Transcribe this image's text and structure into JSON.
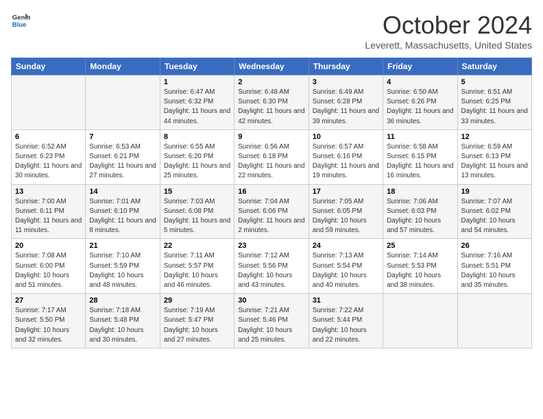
{
  "logo": {
    "text1": "General",
    "text2": "Blue"
  },
  "title": "October 2024",
  "location": "Leverett, Massachusetts, United States",
  "weekdays": [
    "Sunday",
    "Monday",
    "Tuesday",
    "Wednesday",
    "Thursday",
    "Friday",
    "Saturday"
  ],
  "weeks": [
    [
      {
        "day": "",
        "sunrise": "",
        "sunset": "",
        "daylight": ""
      },
      {
        "day": "",
        "sunrise": "",
        "sunset": "",
        "daylight": ""
      },
      {
        "day": "1",
        "sunrise": "Sunrise: 6:47 AM",
        "sunset": "Sunset: 6:32 PM",
        "daylight": "Daylight: 11 hours and 44 minutes."
      },
      {
        "day": "2",
        "sunrise": "Sunrise: 6:48 AM",
        "sunset": "Sunset: 6:30 PM",
        "daylight": "Daylight: 11 hours and 42 minutes."
      },
      {
        "day": "3",
        "sunrise": "Sunrise: 6:49 AM",
        "sunset": "Sunset: 6:28 PM",
        "daylight": "Daylight: 11 hours and 39 minutes."
      },
      {
        "day": "4",
        "sunrise": "Sunrise: 6:50 AM",
        "sunset": "Sunset: 6:26 PM",
        "daylight": "Daylight: 11 hours and 36 minutes."
      },
      {
        "day": "5",
        "sunrise": "Sunrise: 6:51 AM",
        "sunset": "Sunset: 6:25 PM",
        "daylight": "Daylight: 11 hours and 33 minutes."
      }
    ],
    [
      {
        "day": "6",
        "sunrise": "Sunrise: 6:52 AM",
        "sunset": "Sunset: 6:23 PM",
        "daylight": "Daylight: 11 hours and 30 minutes."
      },
      {
        "day": "7",
        "sunrise": "Sunrise: 6:53 AM",
        "sunset": "Sunset: 6:21 PM",
        "daylight": "Daylight: 11 hours and 27 minutes."
      },
      {
        "day": "8",
        "sunrise": "Sunrise: 6:55 AM",
        "sunset": "Sunset: 6:20 PM",
        "daylight": "Daylight: 11 hours and 25 minutes."
      },
      {
        "day": "9",
        "sunrise": "Sunrise: 6:56 AM",
        "sunset": "Sunset: 6:18 PM",
        "daylight": "Daylight: 11 hours and 22 minutes."
      },
      {
        "day": "10",
        "sunrise": "Sunrise: 6:57 AM",
        "sunset": "Sunset: 6:16 PM",
        "daylight": "Daylight: 11 hours and 19 minutes."
      },
      {
        "day": "11",
        "sunrise": "Sunrise: 6:58 AM",
        "sunset": "Sunset: 6:15 PM",
        "daylight": "Daylight: 11 hours and 16 minutes."
      },
      {
        "day": "12",
        "sunrise": "Sunrise: 6:59 AM",
        "sunset": "Sunset: 6:13 PM",
        "daylight": "Daylight: 11 hours and 13 minutes."
      }
    ],
    [
      {
        "day": "13",
        "sunrise": "Sunrise: 7:00 AM",
        "sunset": "Sunset: 6:11 PM",
        "daylight": "Daylight: 11 hours and 11 minutes."
      },
      {
        "day": "14",
        "sunrise": "Sunrise: 7:01 AM",
        "sunset": "Sunset: 6:10 PM",
        "daylight": "Daylight: 11 hours and 8 minutes."
      },
      {
        "day": "15",
        "sunrise": "Sunrise: 7:03 AM",
        "sunset": "Sunset: 6:08 PM",
        "daylight": "Daylight: 11 hours and 5 minutes."
      },
      {
        "day": "16",
        "sunrise": "Sunrise: 7:04 AM",
        "sunset": "Sunset: 6:06 PM",
        "daylight": "Daylight: 11 hours and 2 minutes."
      },
      {
        "day": "17",
        "sunrise": "Sunrise: 7:05 AM",
        "sunset": "Sunset: 6:05 PM",
        "daylight": "Daylight: 10 hours and 59 minutes."
      },
      {
        "day": "18",
        "sunrise": "Sunrise: 7:06 AM",
        "sunset": "Sunset: 6:03 PM",
        "daylight": "Daylight: 10 hours and 57 minutes."
      },
      {
        "day": "19",
        "sunrise": "Sunrise: 7:07 AM",
        "sunset": "Sunset: 6:02 PM",
        "daylight": "Daylight: 10 hours and 54 minutes."
      }
    ],
    [
      {
        "day": "20",
        "sunrise": "Sunrise: 7:08 AM",
        "sunset": "Sunset: 6:00 PM",
        "daylight": "Daylight: 10 hours and 51 minutes."
      },
      {
        "day": "21",
        "sunrise": "Sunrise: 7:10 AM",
        "sunset": "Sunset: 5:59 PM",
        "daylight": "Daylight: 10 hours and 48 minutes."
      },
      {
        "day": "22",
        "sunrise": "Sunrise: 7:11 AM",
        "sunset": "Sunset: 5:57 PM",
        "daylight": "Daylight: 10 hours and 46 minutes."
      },
      {
        "day": "23",
        "sunrise": "Sunrise: 7:12 AM",
        "sunset": "Sunset: 5:56 PM",
        "daylight": "Daylight: 10 hours and 43 minutes."
      },
      {
        "day": "24",
        "sunrise": "Sunrise: 7:13 AM",
        "sunset": "Sunset: 5:54 PM",
        "daylight": "Daylight: 10 hours and 40 minutes."
      },
      {
        "day": "25",
        "sunrise": "Sunrise: 7:14 AM",
        "sunset": "Sunset: 5:53 PM",
        "daylight": "Daylight: 10 hours and 38 minutes."
      },
      {
        "day": "26",
        "sunrise": "Sunrise: 7:16 AM",
        "sunset": "Sunset: 5:51 PM",
        "daylight": "Daylight: 10 hours and 35 minutes."
      }
    ],
    [
      {
        "day": "27",
        "sunrise": "Sunrise: 7:17 AM",
        "sunset": "Sunset: 5:50 PM",
        "daylight": "Daylight: 10 hours and 32 minutes."
      },
      {
        "day": "28",
        "sunrise": "Sunrise: 7:18 AM",
        "sunset": "Sunset: 5:48 PM",
        "daylight": "Daylight: 10 hours and 30 minutes."
      },
      {
        "day": "29",
        "sunrise": "Sunrise: 7:19 AM",
        "sunset": "Sunset: 5:47 PM",
        "daylight": "Daylight: 10 hours and 27 minutes."
      },
      {
        "day": "30",
        "sunrise": "Sunrise: 7:21 AM",
        "sunset": "Sunset: 5:46 PM",
        "daylight": "Daylight: 10 hours and 25 minutes."
      },
      {
        "day": "31",
        "sunrise": "Sunrise: 7:22 AM",
        "sunset": "Sunset: 5:44 PM",
        "daylight": "Daylight: 10 hours and 22 minutes."
      },
      {
        "day": "",
        "sunrise": "",
        "sunset": "",
        "daylight": ""
      },
      {
        "day": "",
        "sunrise": "",
        "sunset": "",
        "daylight": ""
      }
    ]
  ]
}
